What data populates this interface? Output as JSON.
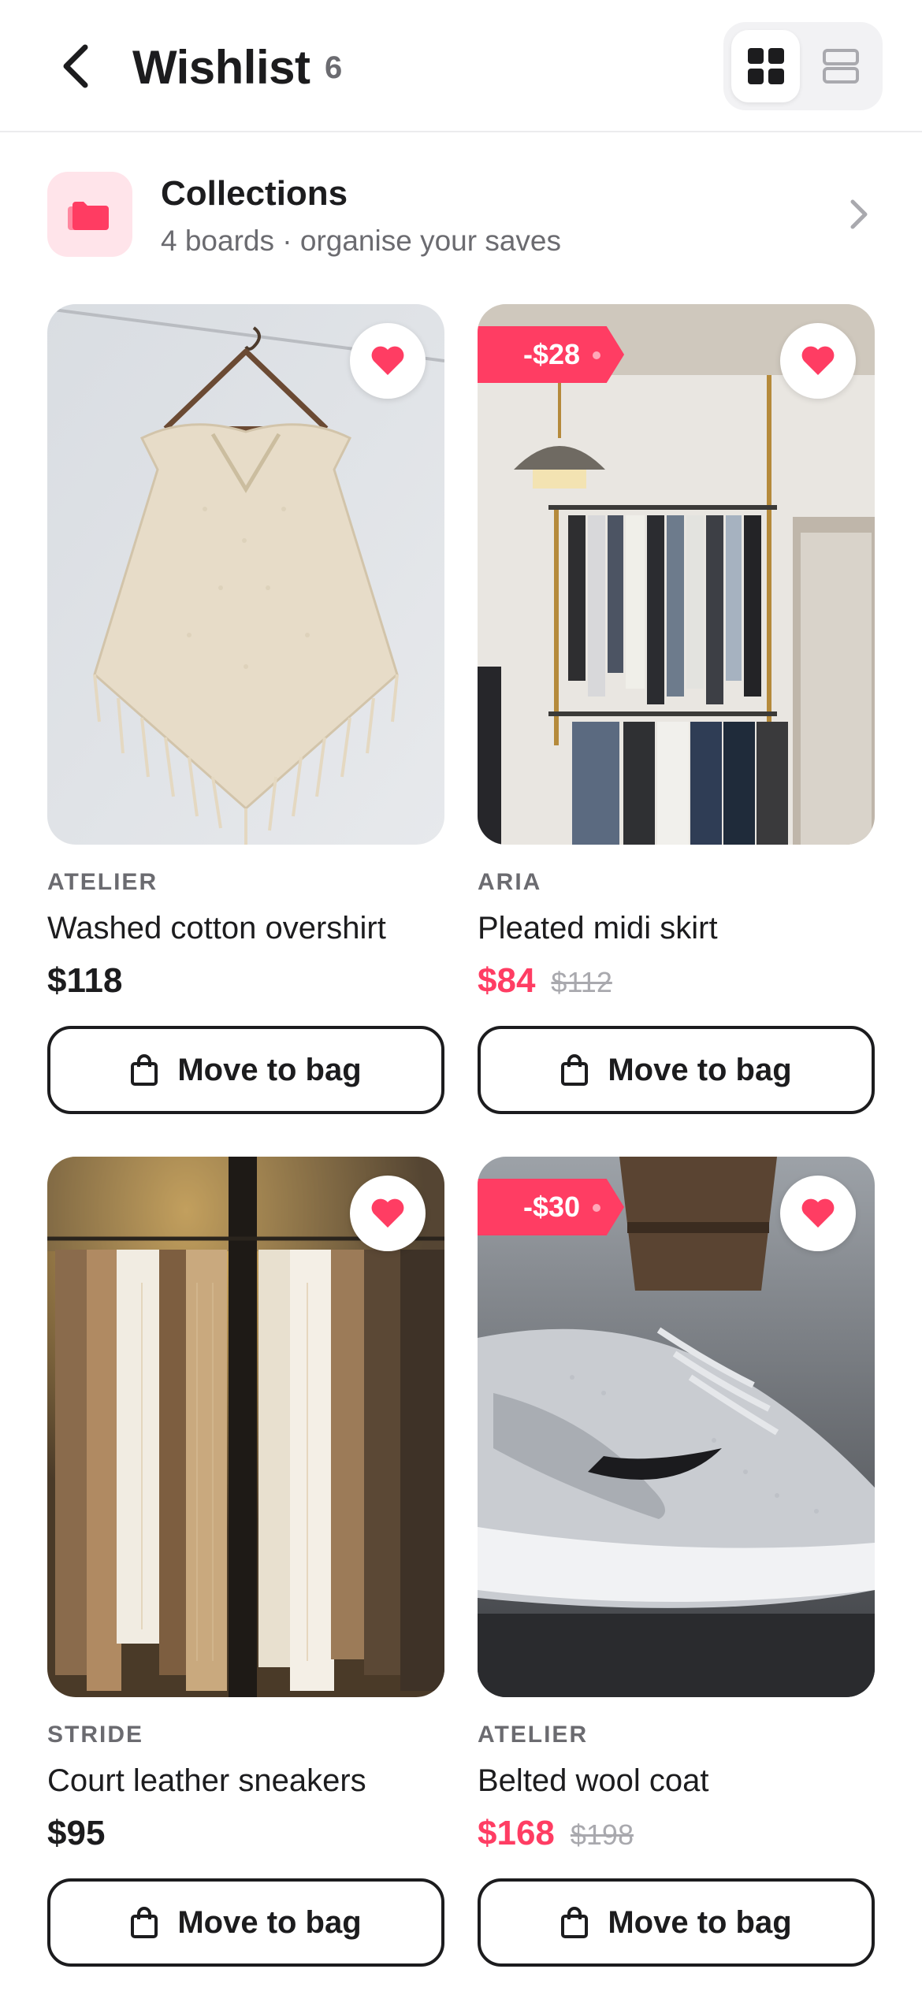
{
  "header": {
    "title": "Wishlist",
    "count": "6",
    "back_icon": "chevron-left-icon",
    "view_grid_icon": "grid-icon",
    "view_list_icon": "list-icon",
    "active_view": "grid"
  },
  "collections": {
    "title": "Collections",
    "subtitle": "4 boards · organise your saves",
    "icon": "folder-icon"
  },
  "colors": {
    "accent": "#ff3d63",
    "text": "#1c1c1e",
    "muted": "#6b6b70",
    "icon_bg": "#ffe4ea"
  },
  "products": [
    {
      "brand": "ATELIER",
      "name": "Washed cotton overshirt",
      "price": "$118",
      "old_price": "",
      "discount": "",
      "on_sale": false,
      "liked": true,
      "button": "Move to bag",
      "image": "cream knit poncho on hanger"
    },
    {
      "brand": "ARIA",
      "name": "Pleated midi skirt",
      "price": "$84",
      "old_price": "$112",
      "discount": "-$28",
      "on_sale": true,
      "liked": true,
      "button": "Move to bag",
      "image": "clothing store racks with pendant lamp"
    },
    {
      "brand": "STRIDE",
      "name": "Court leather sneakers",
      "price": "$95",
      "old_price": "",
      "discount": "",
      "on_sale": false,
      "liked": true,
      "button": "Move to bag",
      "image": "beige knitwear on rack"
    },
    {
      "brand": "ATELIER",
      "name": "Belted wool coat",
      "price": "$168",
      "old_price": "$198",
      "discount": "-$30",
      "on_sale": true,
      "liked": true,
      "button": "Move to bag",
      "image": "grey sneaker close-up"
    }
  ]
}
